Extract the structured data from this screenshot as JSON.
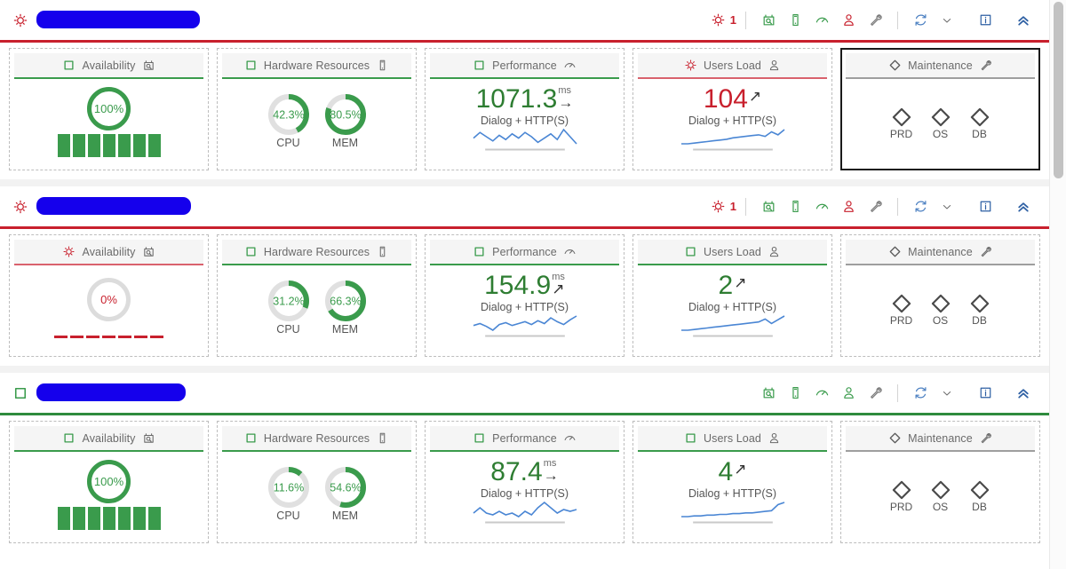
{
  "app": {
    "scrollbar": {
      "thumb_top_pct": 0,
      "thumb_height_pct": 31
    }
  },
  "toolbar_icons": [
    {
      "name": "magnifier-box-icon",
      "label": "System Details"
    },
    {
      "name": "device-icon",
      "label": "Instances"
    },
    {
      "name": "gauge-icon",
      "label": "Performance"
    },
    {
      "name": "user-icon",
      "label": "Users Load"
    },
    {
      "name": "wrench-icon",
      "label": "Maintenance"
    },
    {
      "name": "refresh-icon",
      "label": "Refresh"
    },
    {
      "name": "chevron-down-icon",
      "label": "More"
    },
    {
      "name": "info-icon",
      "label": "Info"
    },
    {
      "name": "collapse-icon",
      "label": "Collapse"
    }
  ],
  "card_titles": {
    "availability": "Availability",
    "hardware": "Hardware Resources",
    "performance": "Performance",
    "users_load": "Users Load",
    "maintenance": "Maintenance"
  },
  "labels": {
    "cpu": "CPU",
    "mem": "MEM",
    "dialog_http": "Dialog + HTTP(S)",
    "ms": "ms",
    "prd": "PRD",
    "os": "OS",
    "db": "DB"
  },
  "colors": {
    "green": "#3a9b4c",
    "dark_green": "#2e7d32",
    "red": "#c8202d",
    "gray": "#9e9e9e",
    "blue_spark": "#4a86d4",
    "redaction": "#1500ec"
  },
  "systems": [
    {
      "status": "alert",
      "header_rule": "red",
      "status_icon": "alert-sun-icon",
      "title_redacted": true,
      "redaction_width": 184,
      "alert_count": "1",
      "toolbar_icon_states": [
        "green",
        "green",
        "green",
        "red",
        "gray"
      ],
      "availability": {
        "status": "ok",
        "icon": "square-icon",
        "rule": "green",
        "value": "100%",
        "percent": 100,
        "bars_filled": true,
        "bars": 7
      },
      "hardware": {
        "status": "ok",
        "icon": "square-icon",
        "rule": "green",
        "cpu": {
          "value": "42.3%",
          "percent": 42.3
        },
        "mem": {
          "value": "80.5%",
          "percent": 80.5
        }
      },
      "performance": {
        "status": "ok",
        "icon": "square-icon",
        "rule": "green",
        "value": "1071.3",
        "unit": "ms",
        "trend": "flat",
        "sub": "Dialog + HTTP(S)",
        "sparkline": [
          10,
          6,
          9,
          12,
          8,
          11,
          7,
          10,
          6,
          9,
          13,
          10,
          7,
          11,
          4,
          9,
          14
        ]
      },
      "users_load": {
        "status": "alert",
        "icon": "alert-sun-icon",
        "rule": "red",
        "value": "104",
        "trend": "up",
        "sub": "Dialog + HTTP(S)",
        "sparkline": [
          20,
          20,
          19,
          18,
          17,
          16,
          15,
          14,
          12,
          11,
          10,
          9,
          8,
          10,
          4,
          8,
          1
        ]
      },
      "maintenance": {
        "status": "neutral",
        "icon": "diamond-icon",
        "rule": "gray",
        "selected": true,
        "items": [
          "PRD",
          "OS",
          "DB"
        ]
      }
    },
    {
      "status": "alert",
      "header_rule": "red",
      "status_icon": "alert-sun-icon",
      "title_redacted": true,
      "redaction_width": 174,
      "alert_count": "1",
      "toolbar_icon_states": [
        "green",
        "green",
        "green",
        "red",
        "gray"
      ],
      "availability": {
        "status": "alert",
        "icon": "alert-sun-icon",
        "rule": "red",
        "value": "0%",
        "percent": 0,
        "bars_filled": false,
        "bars": 7
      },
      "hardware": {
        "status": "ok",
        "icon": "square-icon",
        "rule": "green",
        "cpu": {
          "value": "31.2%",
          "percent": 31.2
        },
        "mem": {
          "value": "66.3%",
          "percent": 66.3
        }
      },
      "performance": {
        "status": "ok",
        "icon": "square-icon",
        "rule": "green",
        "value": "154.9",
        "unit": "ms",
        "trend": "up",
        "sub": "Dialog + HTTP(S)",
        "sparkline": [
          13,
          11,
          14,
          18,
          12,
          10,
          13,
          11,
          9,
          12,
          8,
          11,
          5,
          9,
          12,
          7,
          3
        ]
      },
      "users_load": {
        "status": "ok",
        "icon": "square-icon",
        "rule": "green",
        "value": "2",
        "trend": "up",
        "sub": "Dialog + HTTP(S)",
        "sparkline": [
          20,
          20,
          19,
          18,
          17,
          16,
          15,
          14,
          13,
          12,
          11,
          10,
          9,
          5,
          11,
          6,
          1
        ]
      },
      "maintenance": {
        "status": "neutral",
        "icon": "diamond-icon",
        "rule": "gray",
        "selected": false,
        "items": [
          "PRD",
          "OS",
          "DB"
        ]
      }
    },
    {
      "status": "ok",
      "header_rule": "green",
      "status_icon": "square-icon",
      "title_redacted": true,
      "redaction_width": 168,
      "alert_count": "",
      "toolbar_icon_states": [
        "green",
        "green",
        "green",
        "green",
        "gray"
      ],
      "availability": {
        "status": "ok",
        "icon": "square-icon",
        "rule": "green",
        "value": "100%",
        "percent": 100,
        "bars_filled": true,
        "bars": 7
      },
      "hardware": {
        "status": "ok",
        "icon": "square-icon",
        "rule": "green",
        "cpu": {
          "value": "11.6%",
          "percent": 11.6
        },
        "mem": {
          "value": "54.6%",
          "percent": 54.6
        }
      },
      "performance": {
        "status": "ok",
        "icon": "square-icon",
        "rule": "green",
        "value": "87.4",
        "unit": "ms",
        "trend": "flat",
        "sub": "Dialog + HTTP(S)",
        "sparkline": [
          12,
          9,
          12,
          13,
          11,
          13,
          12,
          14,
          11,
          13,
          9,
          6,
          9,
          12,
          10,
          11,
          10
        ]
      },
      "users_load": {
        "status": "ok",
        "icon": "square-icon",
        "rule": "green",
        "value": "4",
        "trend": "up",
        "sub": "Dialog + HTTP(S)",
        "sparkline": [
          20,
          20,
          19,
          19,
          18,
          18,
          17,
          17,
          16,
          16,
          15,
          15,
          14,
          13,
          12,
          4,
          1
        ]
      },
      "maintenance": {
        "status": "neutral",
        "icon": "diamond-icon",
        "rule": "gray",
        "selected": false,
        "items": [
          "PRD",
          "OS",
          "DB"
        ]
      }
    }
  ]
}
